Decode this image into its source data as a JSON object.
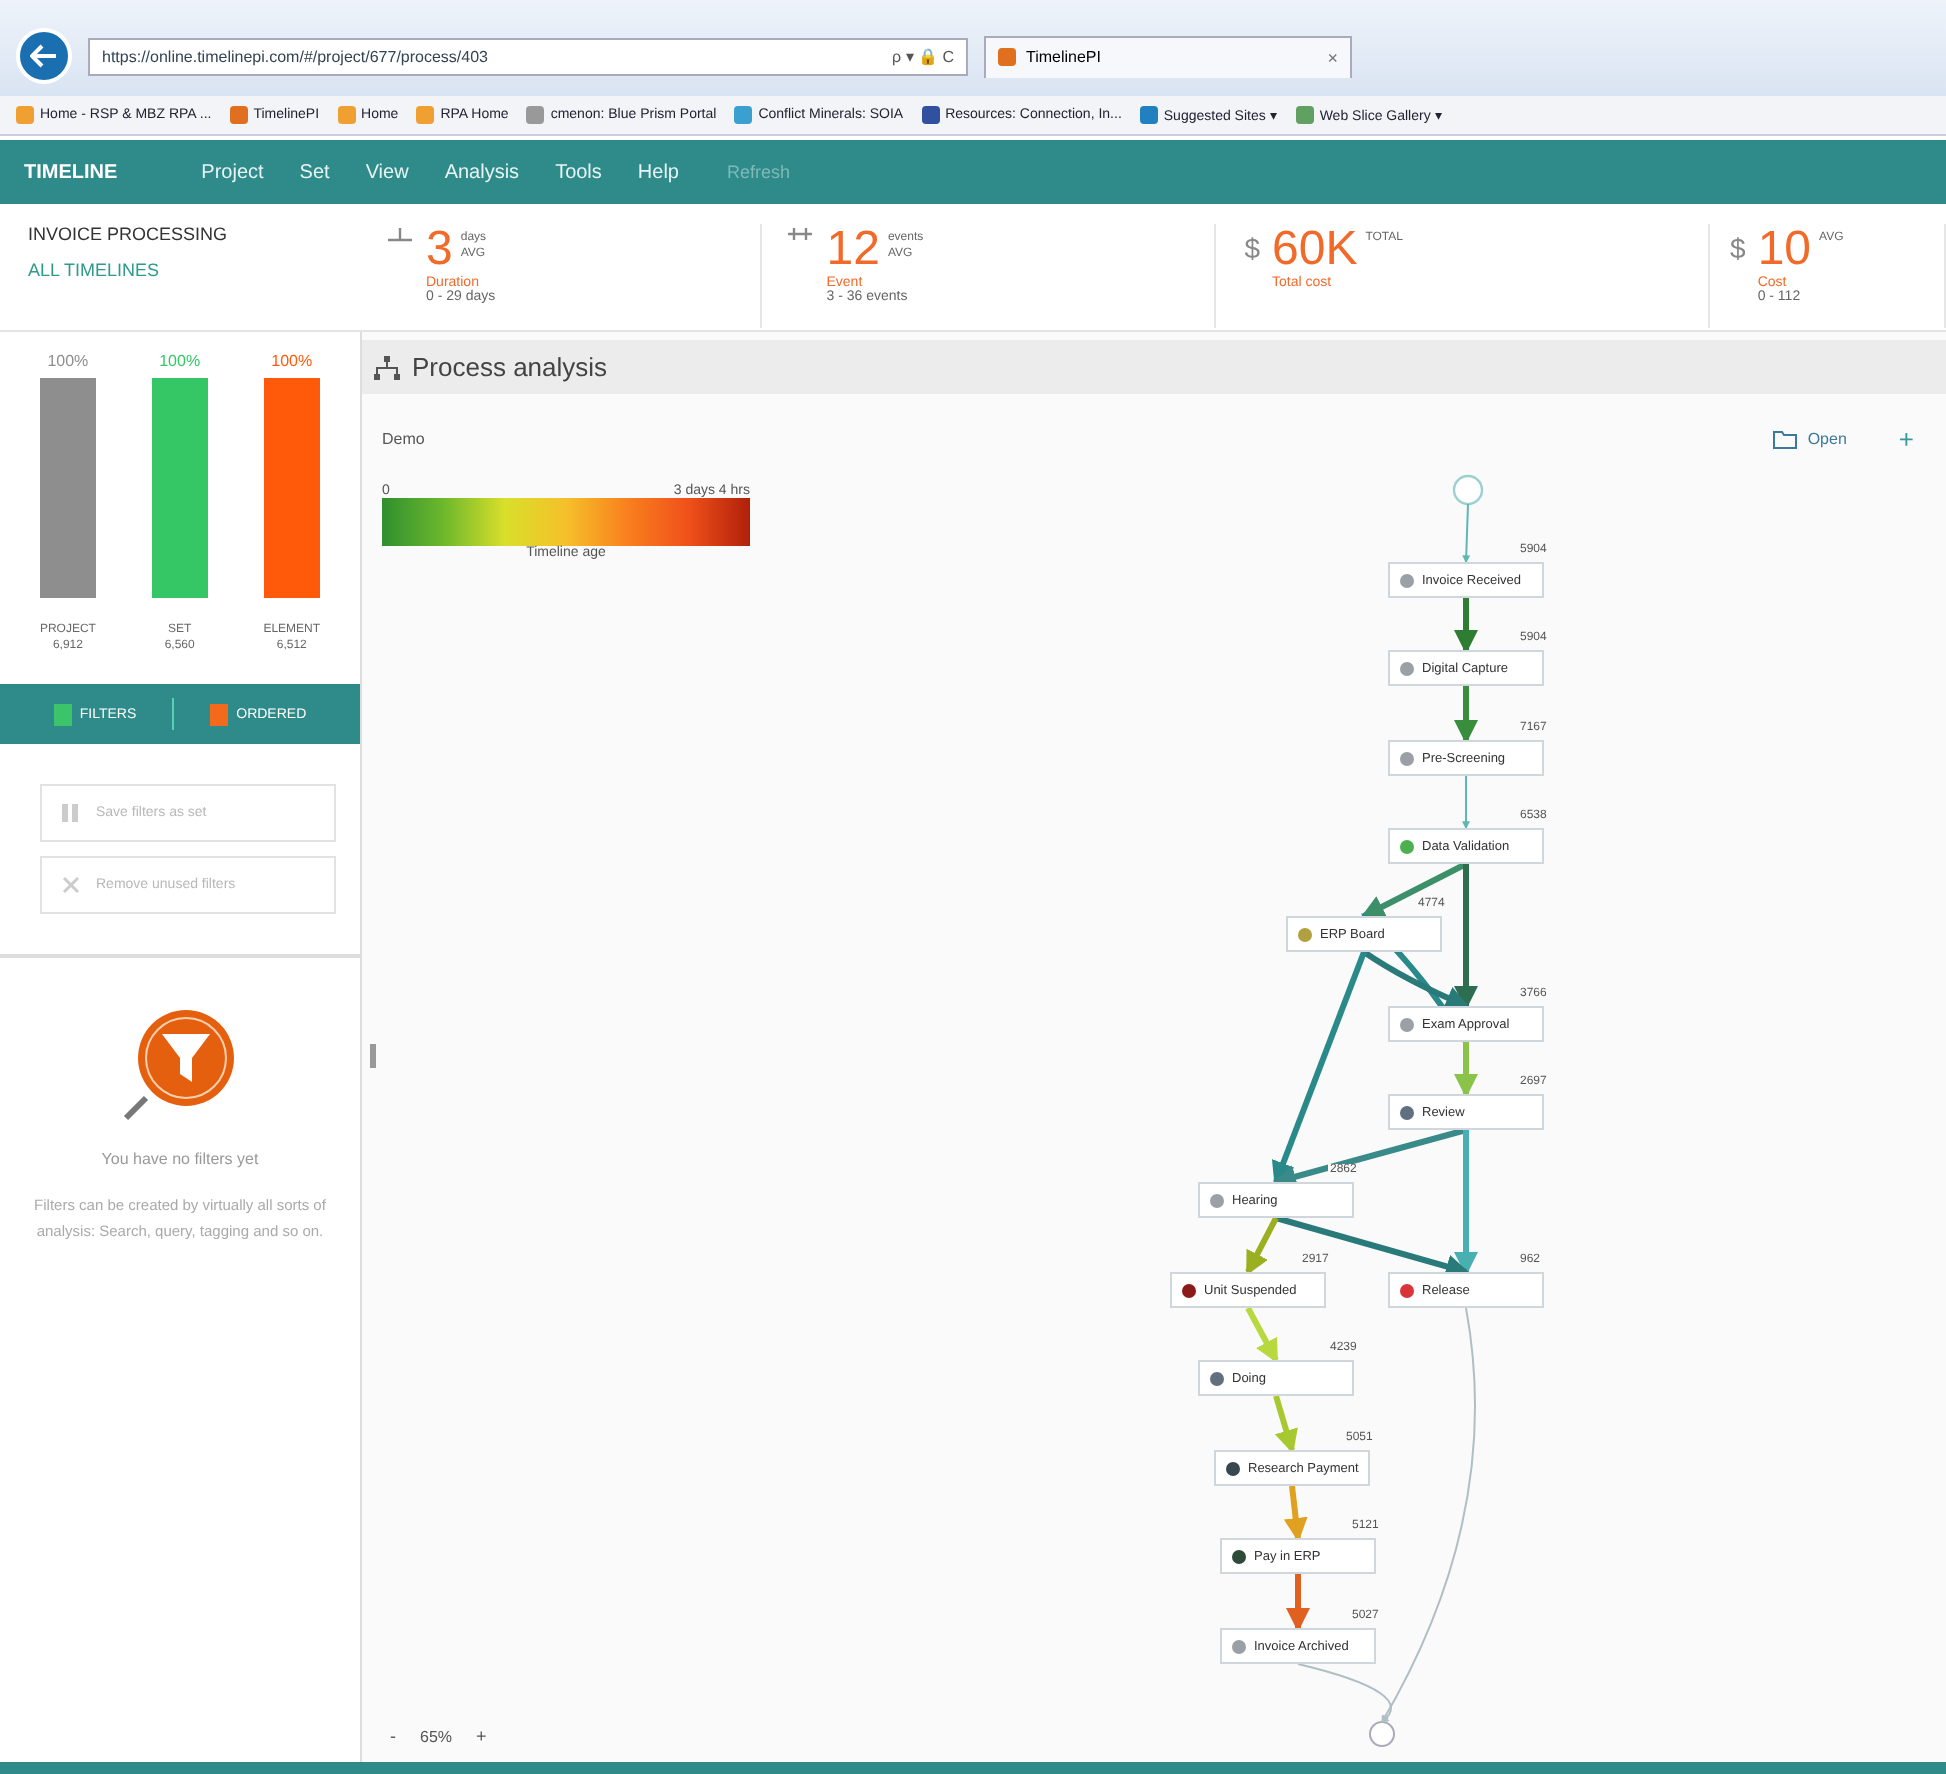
{
  "browser": {
    "url": "https://online.timelinepi.com/#/project/677/process/403",
    "search_hint": "ρ ▾ 🔒 C",
    "tab_title": "TimelinePI",
    "tab_close": "×",
    "bookmarks": [
      "Home - RSP & MBZ RPA ...",
      "TimelinePI",
      "Home",
      "RPA Home",
      "cmenon: Blue Prism Portal",
      "Conflict Minerals: SOIA",
      "Resources: Connection, In...",
      "Suggested Sites ▾",
      "Web Slice Gallery ▾"
    ]
  },
  "app": {
    "logo": "TIMELINE",
    "menu": [
      "Project",
      "Set",
      "View",
      "Analysis",
      "Tools",
      "Help"
    ],
    "refresh": {
      "label": "Refresh",
      "disabled": true
    }
  },
  "header": {
    "title": "INVOICE PROCESSING",
    "subtitle": "ALL TIMELINES",
    "metrics": [
      {
        "kind": "duration",
        "value": "3",
        "unit": "days",
        "stat": "AVG",
        "label": "Duration",
        "range": "0 - 29 days"
      },
      {
        "kind": "events",
        "value": "12",
        "unit": "events",
        "stat": "AVG",
        "label": "Event",
        "range": "3 - 36 events"
      },
      {
        "kind": "cost",
        "symbol": "$",
        "value": "60K",
        "stat": "TOTAL",
        "label": "Total cost"
      },
      {
        "kind": "cost",
        "symbol": "$",
        "value": "10",
        "stat": "AVG",
        "label": "Cost",
        "range": "0 - 112"
      }
    ]
  },
  "sidebar": {
    "bars": [
      {
        "percent": "100%",
        "label": "PROJECT",
        "count": "6,912",
        "level": 1,
        "color": "#8e8e8e"
      },
      {
        "percent": "100%",
        "label": "SET",
        "count": "6,560",
        "level": 1,
        "color": "#35c765"
      },
      {
        "percent": "100%",
        "label": "ELEMENT",
        "count": "6,512",
        "level": 1,
        "color": "#ff5a0a"
      }
    ],
    "tabs": [
      {
        "label": "FILTERS",
        "color": "#3cc46a"
      },
      {
        "label": "ORDERED",
        "color": "#f36a1d"
      }
    ],
    "actions": [
      {
        "kind": "save",
        "label": "Save filters as set",
        "disabled": true
      },
      {
        "kind": "remove",
        "label": "Remove unused filters",
        "disabled": true
      }
    ],
    "empty": {
      "title": "You have no filters yet",
      "text": "Filters can be created by virtually all sorts of analysis: Search, query, tagging and so on."
    }
  },
  "panel": {
    "title": "Process analysis",
    "name": "Demo",
    "open": "Open",
    "add": "+",
    "legend": {
      "min": "0",
      "max": "3 days 4 hrs",
      "label": "Timeline age"
    },
    "nodes": [
      {
        "name": "Invoice Received",
        "count": "5904",
        "color": "#9aa0a6"
      },
      {
        "name": "Digital Capture",
        "count": "5904",
        "color": "#9aa0a6"
      },
      {
        "name": "Pre-Screening",
        "count": "7167",
        "color": "#9aa0a6"
      },
      {
        "name": "Data Validation",
        "count": "6538",
        "color": "#4caf50"
      },
      {
        "name": "ERP Board",
        "count": "4774",
        "color": "#b0a040"
      },
      {
        "name": "Exam Approval",
        "count": "3766",
        "color": "#9aa0a6"
      },
      {
        "name": "Review",
        "count": "2697",
        "color": "#607080"
      },
      {
        "name": "Hearing",
        "count": "2862",
        "color": "#9aa0a6"
      },
      {
        "name": "Unit Suspended",
        "count": "2917",
        "color": "#8b1a1a"
      },
      {
        "name": "Release",
        "count": "962",
        "color": "#d9343a"
      },
      {
        "name": "Doing",
        "count": "4239",
        "color": "#607080"
      },
      {
        "name": "Research Payment",
        "count": "5051",
        "color": "#37474f"
      },
      {
        "name": "Pay in ERP",
        "count": "5121",
        "color": "#2e4a3a"
      },
      {
        "name": "Invoice Archived",
        "count": "5027",
        "color": "#9aa0a6"
      }
    ],
    "zoom": {
      "minus": "-",
      "value": "65%",
      "plus": "+"
    }
  }
}
